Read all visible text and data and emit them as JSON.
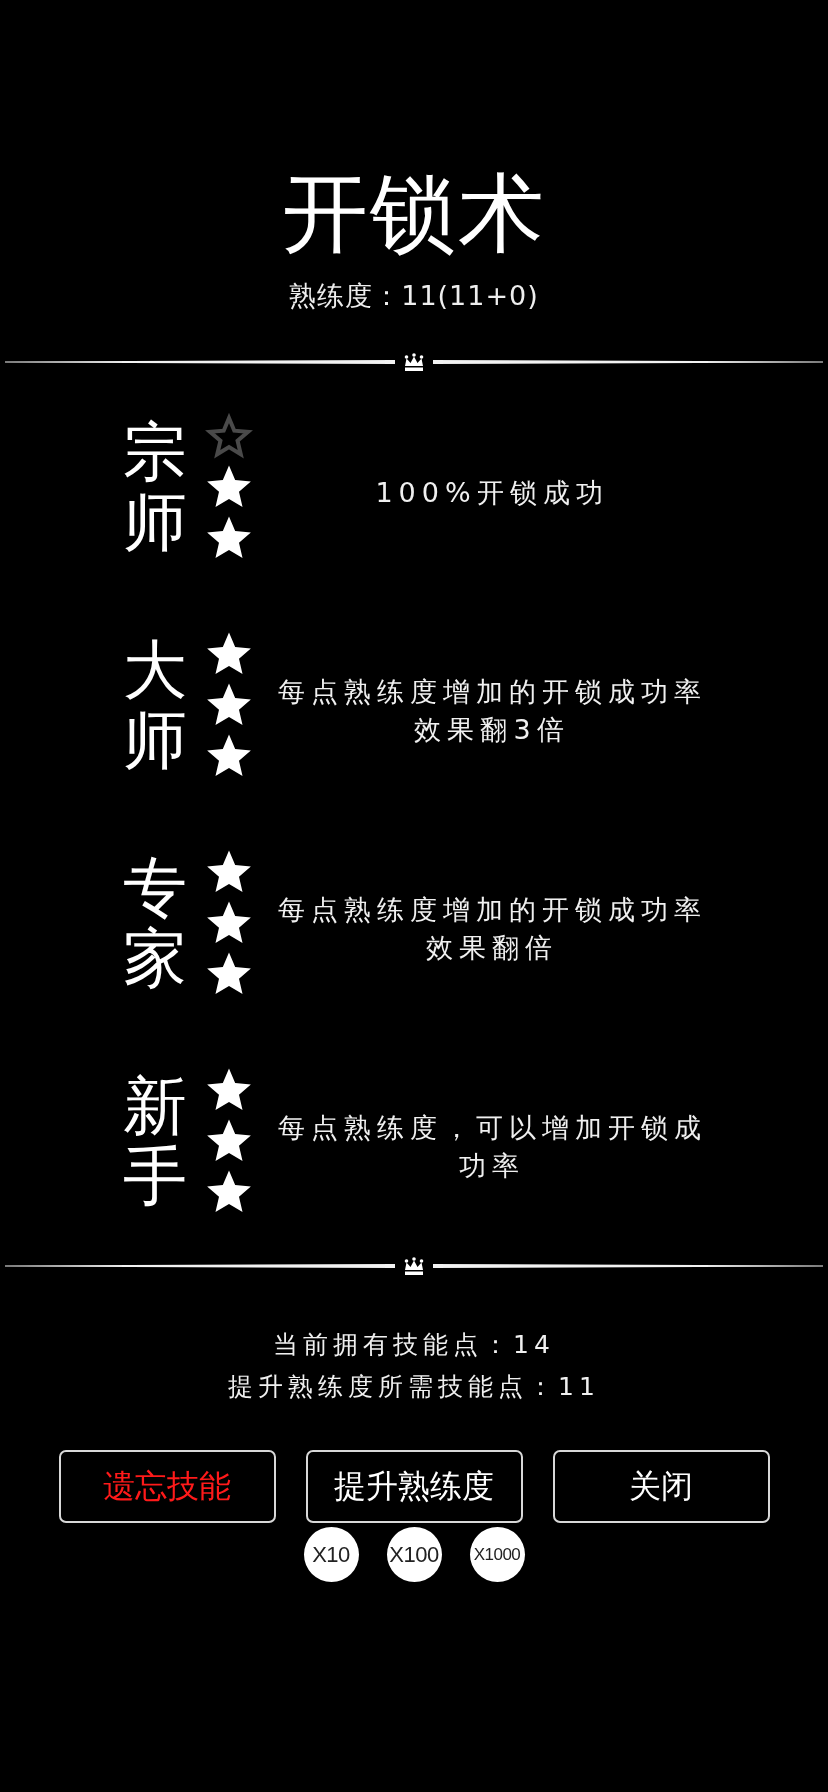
{
  "skill": {
    "title": "开锁术",
    "proficiency": "熟练度：11(11+0)"
  },
  "ranks": [
    {
      "name": "宗师",
      "star_slots": [
        {
          "filled": false
        },
        {
          "filled": true
        },
        {
          "filled": true
        }
      ],
      "effect": "100%开锁成功"
    },
    {
      "name": "大师",
      "star_slots": [
        {
          "filled": true
        },
        {
          "filled": true
        },
        {
          "filled": true
        }
      ],
      "effect": "每点熟练度增加的开锁成功率效果翻3倍"
    },
    {
      "name": "专家",
      "star_slots": [
        {
          "filled": true
        },
        {
          "filled": true
        },
        {
          "filled": true
        }
      ],
      "effect": "每点熟练度增加的开锁成功率效果翻倍"
    },
    {
      "name": "新手",
      "star_slots": [
        {
          "filled": true
        },
        {
          "filled": true
        },
        {
          "filled": true
        }
      ],
      "effect": "每点熟练度，可以增加开锁成功率"
    }
  ],
  "points": {
    "owned": "当前拥有技能点：14",
    "required": "提升熟练度所需技能点：11"
  },
  "buttons": [
    {
      "label": "遗忘技能",
      "kind": "danger"
    },
    {
      "label": "提升熟练度",
      "kind": "normal"
    },
    {
      "label": "关闭",
      "kind": "normal"
    }
  ],
  "multipliers": [
    "X10",
    "X100",
    "X1000"
  ]
}
